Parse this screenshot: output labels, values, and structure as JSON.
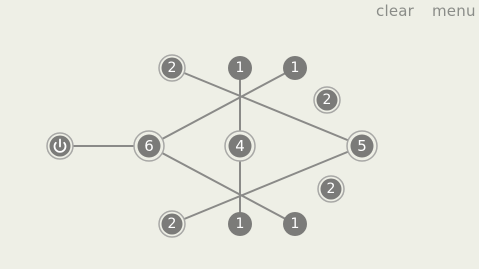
{
  "toolbar": {
    "clear_label": "clear",
    "menu_label": "menu"
  },
  "colors": {
    "background": "#eeefe6",
    "node_fill": "#7b7b79",
    "node_ring": "#a8a8a6",
    "edge": "#8a8a88",
    "text": "#ffffff",
    "menu_text": "#8a8c88"
  },
  "icons": {
    "start_node": "power-icon"
  },
  "nodes": [
    {
      "id": "n-top-left",
      "label": "2",
      "ring": true
    },
    {
      "id": "n-top-mid",
      "label": "1",
      "ring": false
    },
    {
      "id": "n-top-right",
      "label": "1",
      "ring": false
    },
    {
      "id": "n-right-upper",
      "label": "2",
      "ring": true
    },
    {
      "id": "n-start",
      "label": "",
      "ring": true,
      "icon": "power-icon"
    },
    {
      "id": "n-left",
      "label": "6",
      "ring": true
    },
    {
      "id": "n-center",
      "label": "4",
      "ring": true
    },
    {
      "id": "n-right",
      "label": "5",
      "ring": true
    },
    {
      "id": "n-right-lower",
      "label": "2",
      "ring": true
    },
    {
      "id": "n-bottom-left",
      "label": "2",
      "ring": true
    },
    {
      "id": "n-bottom-mid",
      "label": "1",
      "ring": false
    },
    {
      "id": "n-bottom-right",
      "label": "1",
      "ring": false
    }
  ]
}
